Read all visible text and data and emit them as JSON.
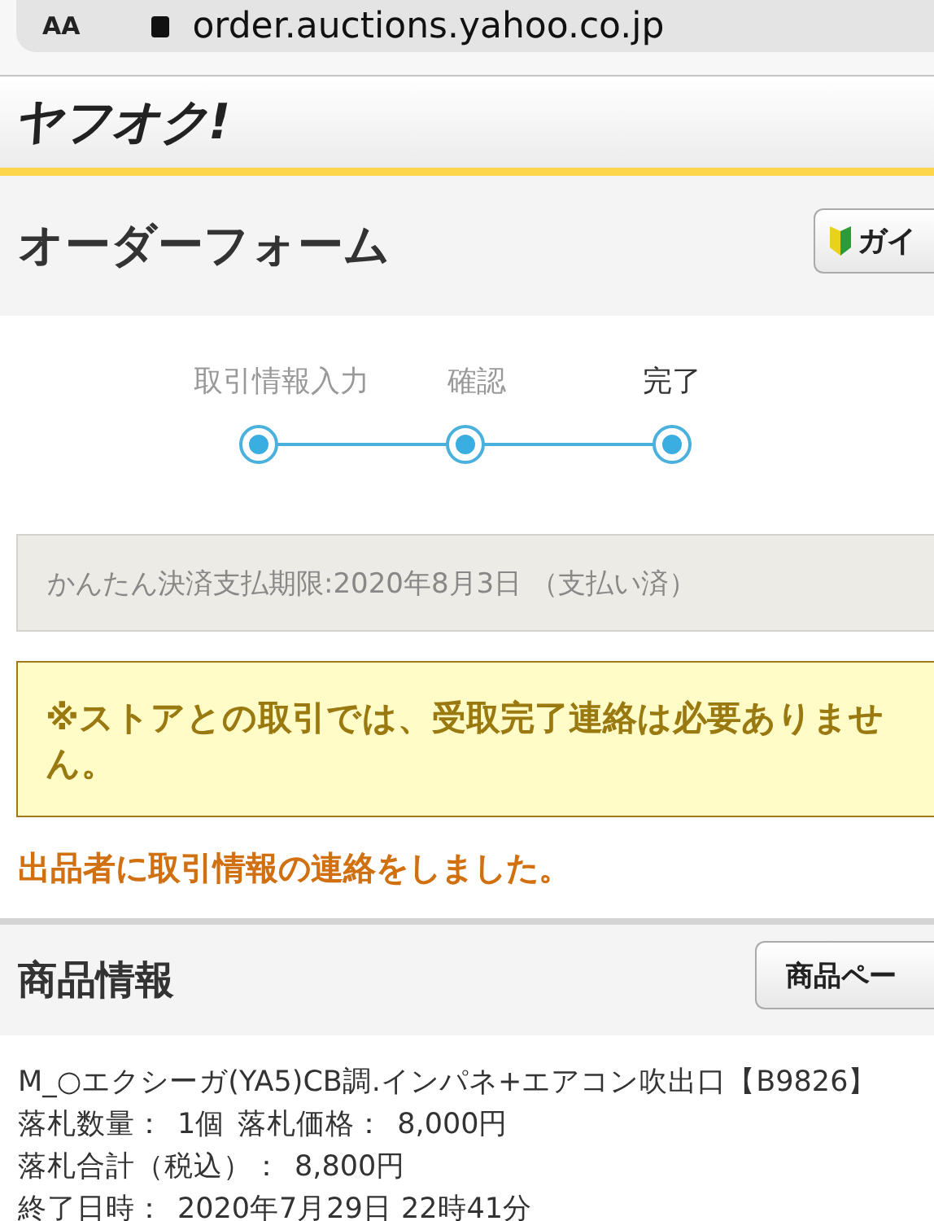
{
  "browser": {
    "text_size_button": "AA",
    "url": "order.auctions.yahoo.co.jp"
  },
  "header": {
    "logo": "ヤフオク!"
  },
  "title_bar": {
    "title": "オーダーフォーム",
    "guide_button": "ガイ"
  },
  "steps": [
    {
      "label": "取引情報入力",
      "selected": false
    },
    {
      "label": "確認",
      "selected": false
    },
    {
      "label": "完了",
      "selected": true
    }
  ],
  "payment_notice": "かんたん決済支払期限:2020年8月3日 （支払い済）",
  "warning": "※ストアとの取引では、受取完了連絡は必要ありません。",
  "message": "出品者に取引情報の連絡をしました。",
  "product_section": {
    "title": "商品情報",
    "page_button": "商品ペー"
  },
  "product": {
    "name": "M_○エクシーガ(YA5)CB調.インパネ+エアコン吹出口【B9826】",
    "lines": [
      [
        "落札数量：",
        "1個",
        "落札価格：",
        "8,000円"
      ],
      [
        "落札合計（税込）：",
        "8,800円"
      ],
      [
        "終了日時：",
        "2020年7月29日 22時41分"
      ]
    ]
  }
}
